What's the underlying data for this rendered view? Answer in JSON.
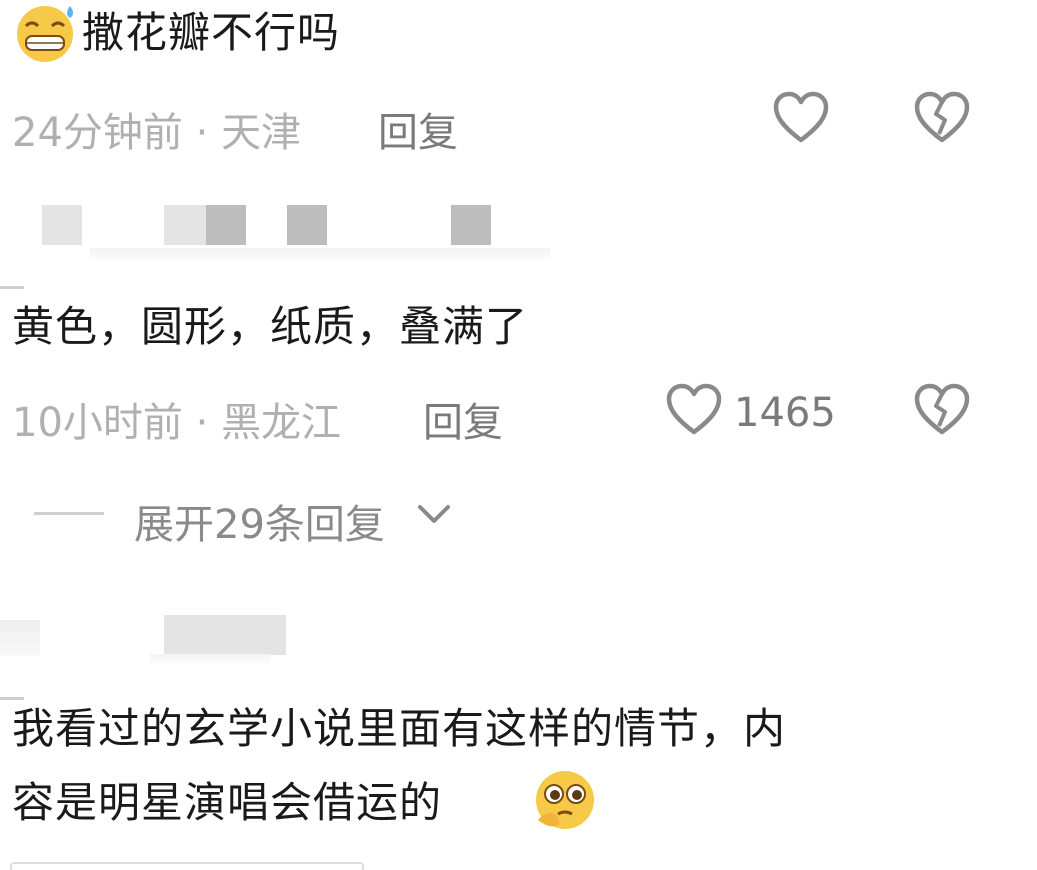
{
  "comments": [
    {
      "emoji_icon": "grinning-sweat-emoji-icon",
      "text": "撒花瓣不行吗",
      "time": "24分钟前",
      "location": "天津",
      "reply_label": "回复",
      "like_count": ""
    },
    {
      "text": "黄色，圆形，纸质，叠满了",
      "time": "10小时前",
      "location": "黑龙江",
      "reply_label": "回复",
      "like_count": "1465",
      "expand_label": "展开29条回复"
    },
    {
      "text_line1": "我看过的玄学小说里面有这样的情节，内",
      "text_line2": "容是明星演唱会借运的",
      "emoji_icon": "pleading-face-emoji-icon"
    }
  ],
  "meta_separator": " · ",
  "colors": {
    "meta": "#b0b0b0",
    "icon": "#8a8a8a",
    "text": "#1a1a1a"
  }
}
